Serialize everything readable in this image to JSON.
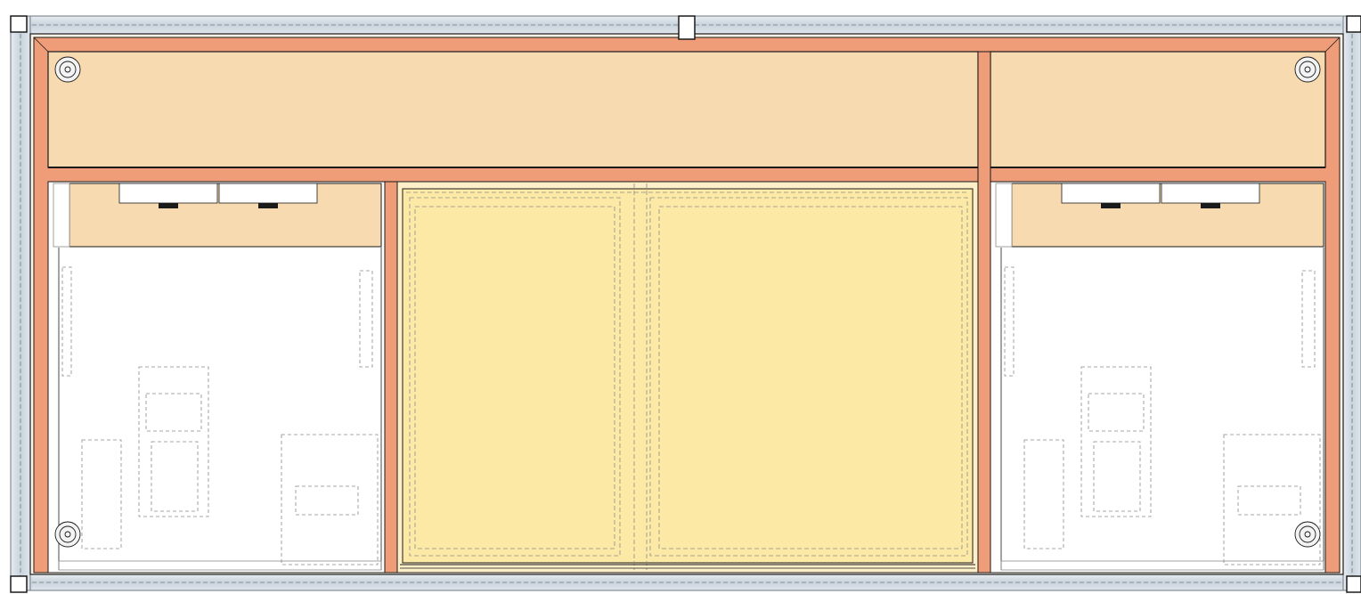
{
  "view": {
    "type": "cabinet-elevation-drawing",
    "selection_handles": [
      "handle-top-left",
      "handle-top-center",
      "handle-top-right",
      "handle-bottom-left",
      "handle-bottom-right"
    ],
    "colors": {
      "frame_steel": "#d3dce4",
      "frame_edge": "#7b8590",
      "carcass": "#ef9c78",
      "panel": "#f8dab0",
      "sliding_door": "#fde9a6",
      "compartment": "#ffffff",
      "line": "#1a1a1a",
      "hidden_line": "#8a8a8a"
    },
    "components": [
      "top-drawer-left",
      "top-drawer-right",
      "left-compartment",
      "center-sliding-doors",
      "right-compartment",
      "left-heater-unit",
      "right-heater-unit",
      "adjustable-feet"
    ]
  }
}
